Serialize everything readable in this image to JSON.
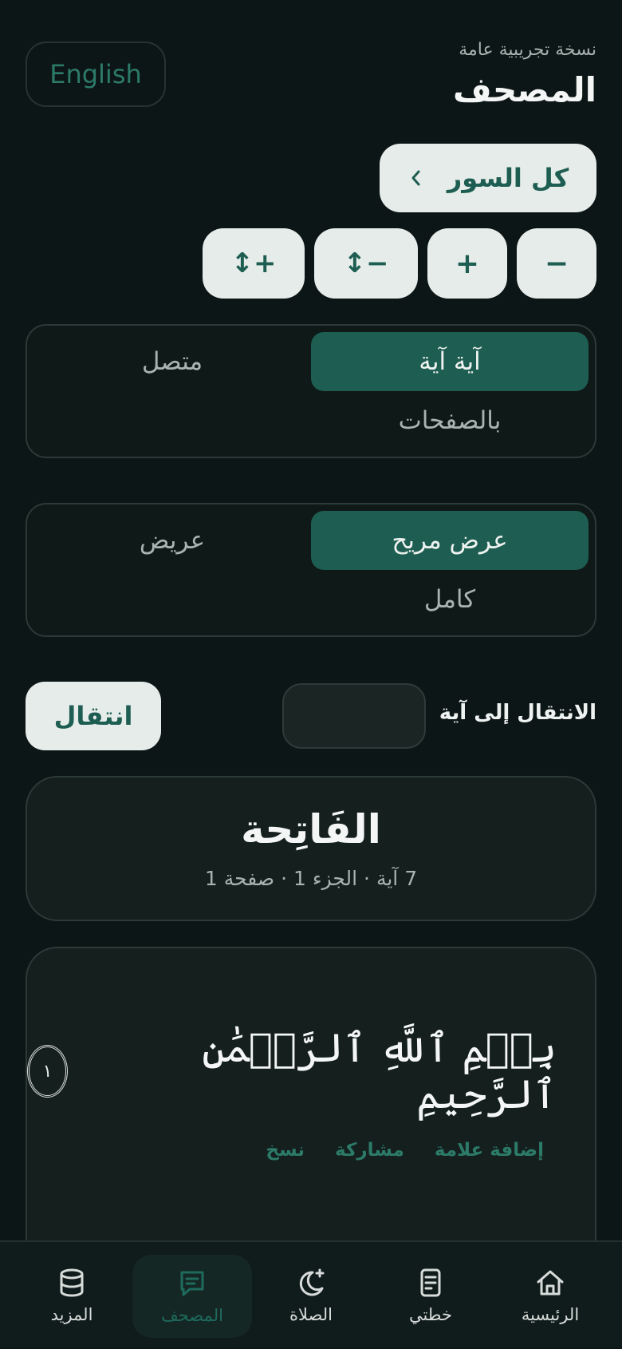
{
  "header": {
    "subtitle": "نسخة تجريبية عامة",
    "title": "المصحف",
    "lang_button": "English"
  },
  "surah_list_button": "كل السور",
  "font_controls": [
    "−",
    "+",
    "↕−",
    "↕+"
  ],
  "mode_toggle": {
    "options": [
      "آية آية",
      "متصل",
      "بالصفحات"
    ],
    "active": "آية آية"
  },
  "width_toggle": {
    "options": [
      "عرض مريح",
      "عريض",
      "كامل"
    ],
    "active": "عرض مريح"
  },
  "jump": {
    "label": "الانتقال إلى آية",
    "input_value": "",
    "button": "انتقال"
  },
  "surah_card": {
    "name": "الفَاتِحة",
    "meta": "7 آية · الجزء 1 · صفحة 1"
  },
  "ayah_card": {
    "text": "بِسۡمِ ٱللَّهِ ٱلرَّحۡمَٰنِ ٱلرَّحِيمِ",
    "number": "١",
    "actions": [
      "نسخ",
      "مشاركة",
      "إضافة علامة"
    ]
  },
  "bottom_nav": {
    "items": [
      {
        "label": "الرئيسية",
        "icon": "home-icon"
      },
      {
        "label": "خطتي",
        "icon": "document-icon"
      },
      {
        "label": "الصلاة",
        "icon": "moon-icon"
      },
      {
        "label": "المصحف",
        "icon": "chat-book-icon"
      },
      {
        "label": "المزيد",
        "icon": "database-icon"
      }
    ],
    "active": "المصحف"
  },
  "colors": {
    "background": "#0d1616",
    "accent": "#1e5d51",
    "accent_text": "#2c7a68",
    "light_button": "#e6ece9"
  }
}
